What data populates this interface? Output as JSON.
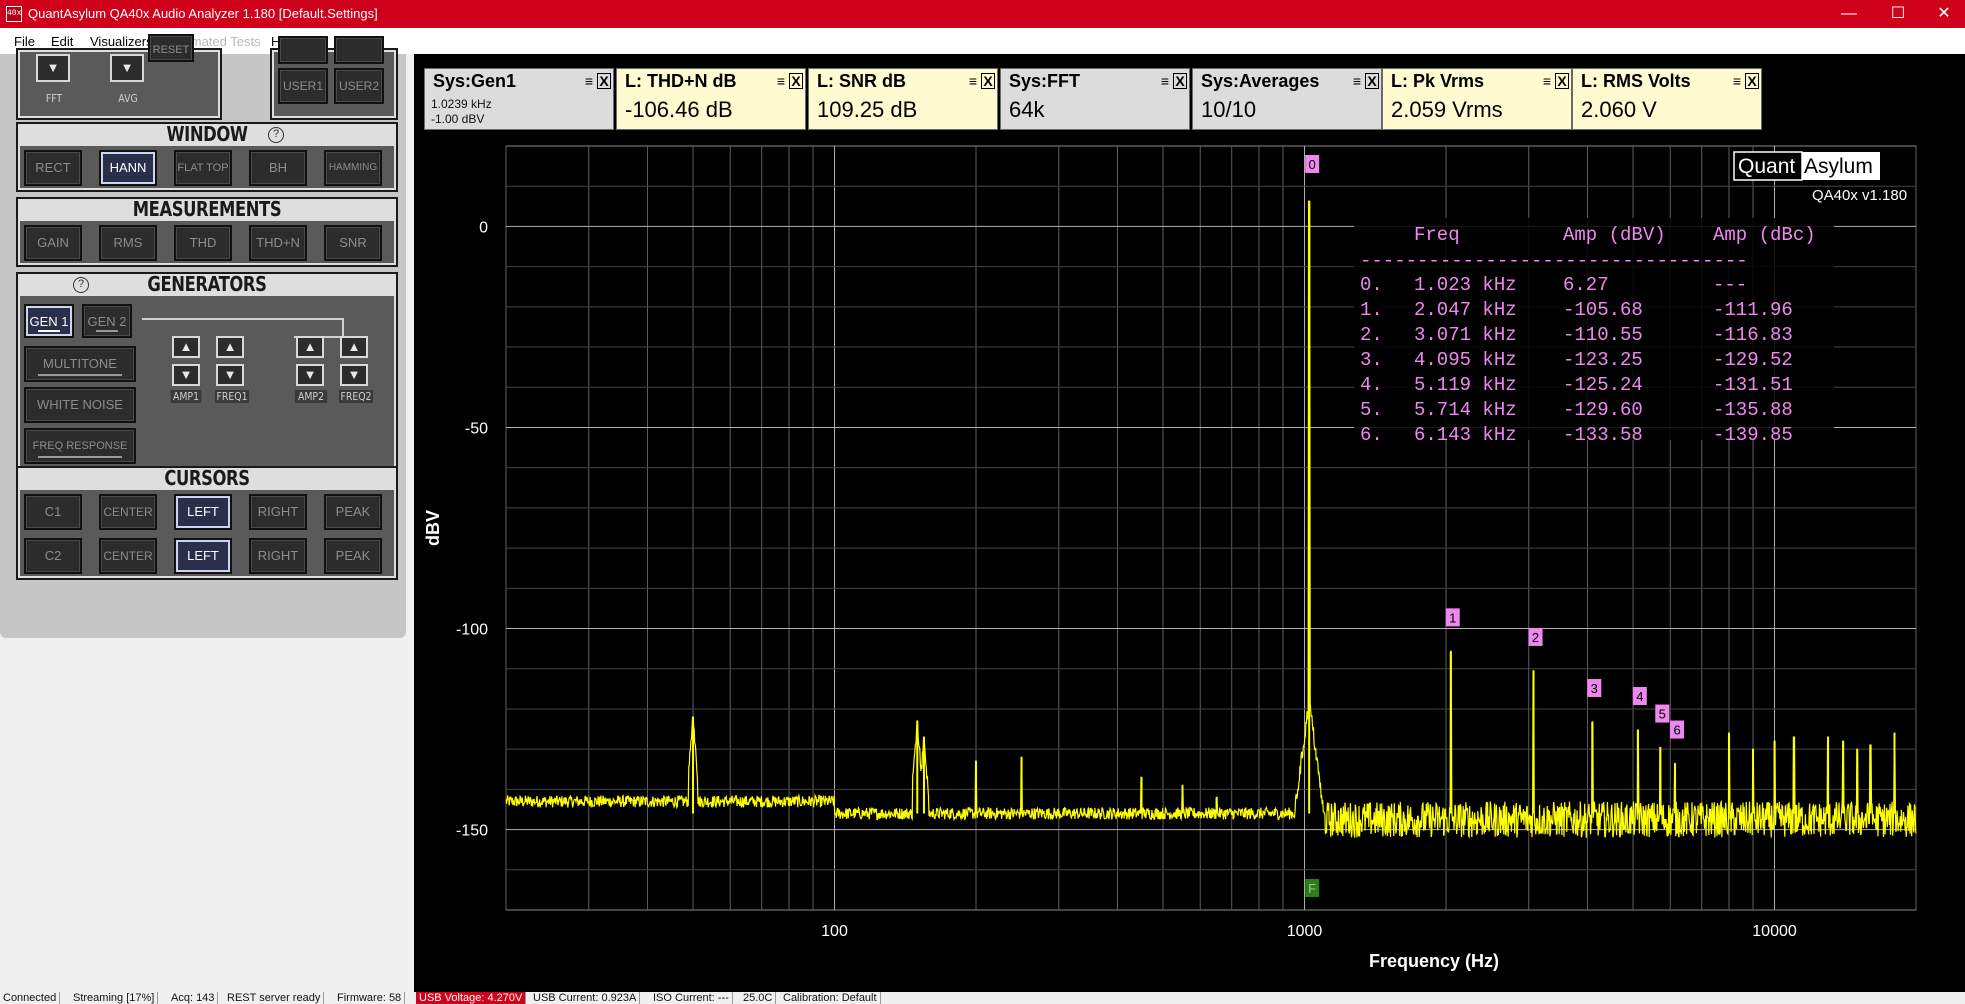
{
  "window": {
    "icon_text": "40x",
    "title": "QuantAsylum QA40x Audio Analyzer 1.180 [Default.Settings]",
    "minimize": "—",
    "maximize": "☐",
    "close": "✕"
  },
  "menu": [
    {
      "label": "File",
      "enabled": true
    },
    {
      "label": "Edit",
      "enabled": true
    },
    {
      "label": "Visualizers",
      "enabled": true
    },
    {
      "label": "Automated Tests",
      "enabled": false
    },
    {
      "label": "Help",
      "enabled": true
    }
  ],
  "top_controls": {
    "fft_label": "FFT",
    "avg_label": "AVG",
    "reset_label": "RESET",
    "user1_label": "USER1",
    "user2_label": "USER2"
  },
  "window_section": {
    "title": "WINDOW",
    "buttons": [
      {
        "label": "RECT",
        "active": false
      },
      {
        "label": "HANN",
        "active": true
      },
      {
        "label": "FLAT TOP",
        "active": false
      },
      {
        "label": "BH",
        "active": false
      },
      {
        "label": "HAMMING",
        "active": false
      }
    ]
  },
  "measurements_section": {
    "title": "MEASUREMENTS",
    "buttons": [
      {
        "label": "GAIN"
      },
      {
        "label": "RMS"
      },
      {
        "label": "THD"
      },
      {
        "label": "THD+N"
      },
      {
        "label": "SNR"
      }
    ]
  },
  "generators_section": {
    "title": "GENERATORS",
    "gen1": "GEN 1",
    "gen2": "GEN 2",
    "multitone": "MULTITONE",
    "white_noise": "WHITE NOISE",
    "freq_response": "FREQ RESPONSE",
    "amp1": "AMP1",
    "freq1": "FREQ1",
    "amp2": "AMP2",
    "freq2": "FREQ2"
  },
  "cursors_section": {
    "title": "CURSORS",
    "row1": [
      {
        "label": "C1",
        "active": false
      },
      {
        "label": "CENTER",
        "active": false
      },
      {
        "label": "LEFT",
        "active": true
      },
      {
        "label": "RIGHT",
        "active": false
      },
      {
        "label": "PEAK",
        "active": false
      }
    ],
    "row2": [
      {
        "label": "C2",
        "active": false
      },
      {
        "label": "CENTER",
        "active": false
      },
      {
        "label": "LEFT",
        "active": true
      },
      {
        "label": "RIGHT",
        "active": false
      },
      {
        "label": "PEAK",
        "active": false
      }
    ]
  },
  "widgets": [
    {
      "title": "Sys:Gen1",
      "type": "sys",
      "sub1": "1.0239 kHz",
      "sub2": "-1.00 dBV",
      "value": ""
    },
    {
      "title": "L: THD+N dB",
      "type": "meas",
      "value": "-106.46 dB"
    },
    {
      "title": "L: SNR dB",
      "type": "meas",
      "value": "109.25 dB"
    },
    {
      "title": "Sys:FFT",
      "type": "sys",
      "value": "64k"
    },
    {
      "title": "Sys:Averages",
      "type": "sys",
      "value": "10/10"
    },
    {
      "title": "L: Pk Vrms",
      "type": "meas",
      "value": "2.059 Vrms"
    },
    {
      "title": "L: RMS Volts",
      "type": "meas",
      "value": "2.060 V"
    }
  ],
  "logo": {
    "quant": "Quant",
    "asylum": "Asylum",
    "version": "QA40x v1.180"
  },
  "harmonic_table": {
    "headers": [
      "Freq",
      "Amp (dBV)",
      "Amp (dBc)"
    ],
    "separator": "----------------------------------",
    "rows": [
      {
        "idx": "0.",
        "freq": "1.023 kHz",
        "dbv": "6.27",
        "dbc": "---"
      },
      {
        "idx": "1.",
        "freq": "2.047 kHz",
        "dbv": "-105.68",
        "dbc": "-111.96"
      },
      {
        "idx": "2.",
        "freq": "3.071 kHz",
        "dbv": "-110.55",
        "dbc": "-116.83"
      },
      {
        "idx": "3.",
        "freq": "4.095 kHz",
        "dbv": "-123.25",
        "dbc": "-129.52"
      },
      {
        "idx": "4.",
        "freq": "5.119 kHz",
        "dbv": "-125.24",
        "dbc": "-131.51"
      },
      {
        "idx": "5.",
        "freq": "5.714 kHz",
        "dbv": "-129.60",
        "dbc": "-135.88"
      },
      {
        "idx": "6.",
        "freq": "6.143 kHz",
        "dbv": "-133.58",
        "dbc": "-139.85"
      }
    ]
  },
  "colors": {
    "trace": "#ffff00",
    "marker": "#ee88ee",
    "grid": "#8c8c8c",
    "fundamental_marker": "#2e7d1a"
  },
  "chart_data": {
    "type": "line",
    "xlabel": "Frequency (Hz)",
    "ylabel": "dBV",
    "xscale": "log",
    "xlim": [
      20,
      20000
    ],
    "ylim": [
      -170,
      20
    ],
    "x_ticks": [
      100,
      1000,
      10000
    ],
    "x_tick_labels": [
      "100",
      "1000",
      "10000"
    ],
    "y_ticks": [
      0,
      -50,
      -100,
      -150
    ],
    "y_tick_labels": [
      "0",
      "-50",
      "-100",
      "-150"
    ],
    "grid": true,
    "noise_floor_dbv": -146,
    "fundamental": {
      "x": 1023,
      "y": 6.27,
      "label": "0"
    },
    "harmonic_markers": [
      {
        "label": "1",
        "x": 2047,
        "y": -105.68
      },
      {
        "label": "2",
        "x": 3071,
        "y": -110.55
      },
      {
        "label": "3",
        "x": 4095,
        "y": -123.25
      },
      {
        "label": "4",
        "x": 5119,
        "y": -125.24
      },
      {
        "label": "5",
        "x": 5714,
        "y": -129.6
      },
      {
        "label": "6",
        "x": 6143,
        "y": -133.58
      }
    ],
    "spurs": [
      {
        "x": 50,
        "y": -122
      },
      {
        "x": 150,
        "y": -123
      },
      {
        "x": 155,
        "y": -127
      },
      {
        "x": 200,
        "y": -133
      },
      {
        "x": 250,
        "y": -132
      },
      {
        "x": 450,
        "y": -137
      },
      {
        "x": 550,
        "y": -139
      },
      {
        "x": 650,
        "y": -142
      },
      {
        "x": 8000,
        "y": -126
      },
      {
        "x": 9000,
        "y": -130
      },
      {
        "x": 10000,
        "y": -128
      },
      {
        "x": 11000,
        "y": -127
      },
      {
        "x": 13000,
        "y": -127
      },
      {
        "x": 14000,
        "y": -128
      },
      {
        "x": 15000,
        "y": -130
      },
      {
        "x": 16000,
        "y": -129
      },
      {
        "x": 18000,
        "y": -126
      }
    ],
    "fundamental_flag": "F"
  },
  "status": [
    {
      "text": "Connected",
      "warn": false
    },
    {
      "text": "Streaming [17%]",
      "warn": false
    },
    {
      "text": "Acq: 143",
      "warn": false
    },
    {
      "text": "REST server ready",
      "warn": false
    },
    {
      "text": "Firmware: 58",
      "warn": false
    },
    {
      "text": "USB Voltage: 4.270V",
      "warn": true
    },
    {
      "text": "USB Current: 0.923A",
      "warn": false
    },
    {
      "text": "ISO Current: ---",
      "warn": false
    },
    {
      "text": "25.0C",
      "warn": false
    },
    {
      "text": "Calibration: Default",
      "warn": false
    }
  ]
}
